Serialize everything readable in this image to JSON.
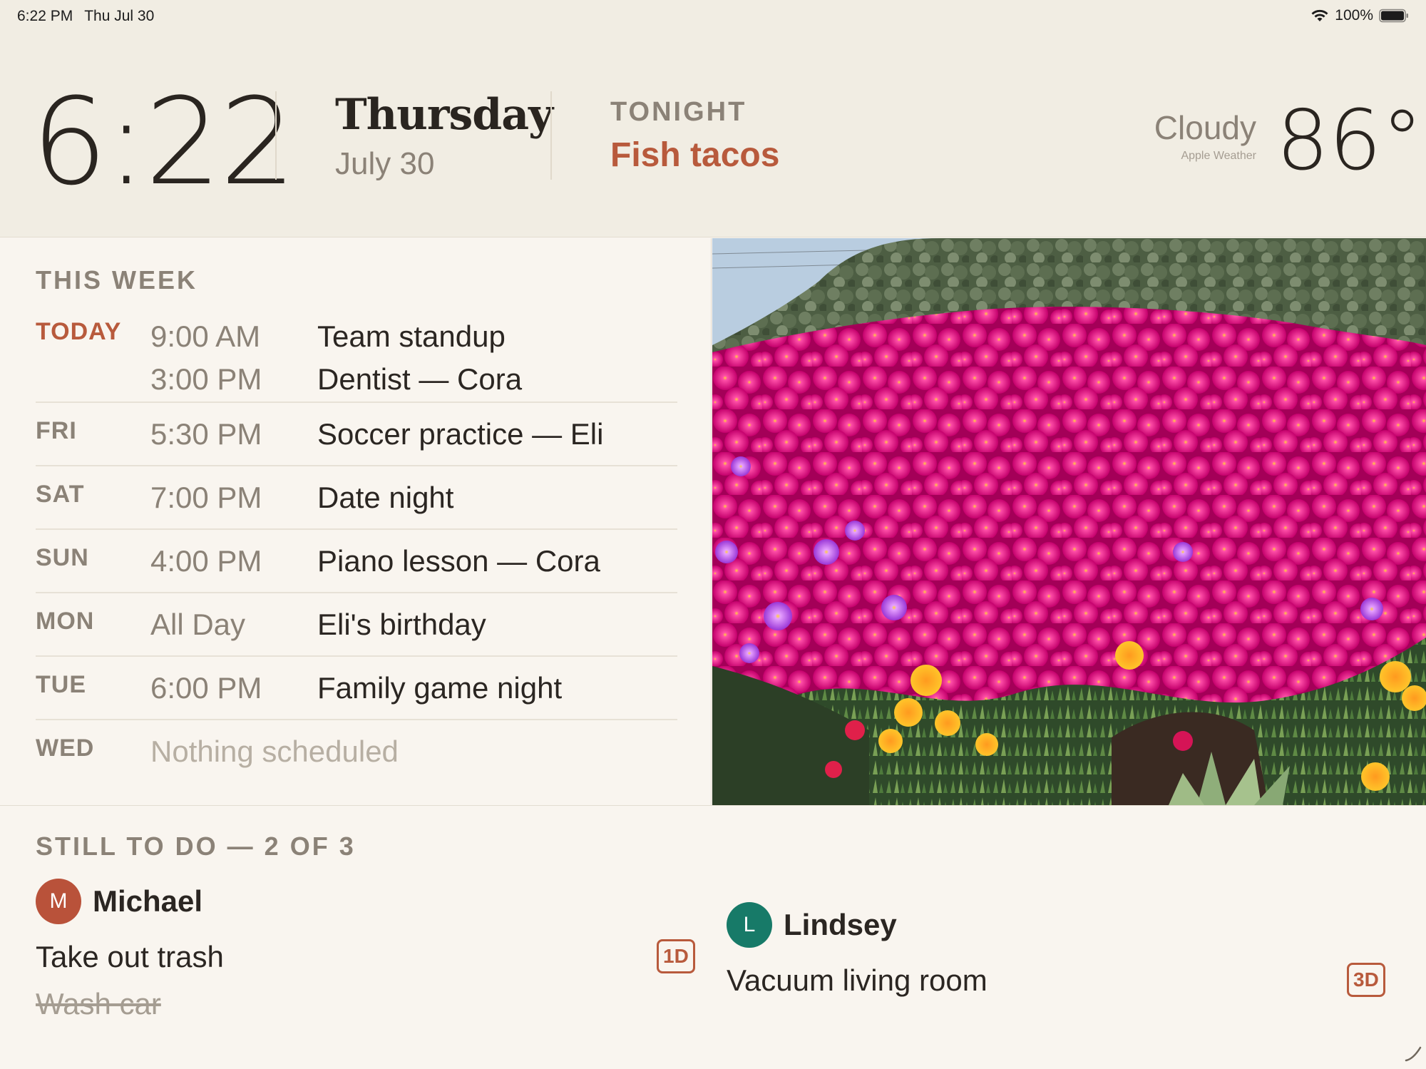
{
  "status_bar": {
    "time": "6:22 PM",
    "date": "Thu Jul 30",
    "battery": "100%",
    "icons": [
      "wifi-icon",
      "battery-icon"
    ]
  },
  "header": {
    "clock": "6:22",
    "day_name": "Thursday",
    "date": "July 30",
    "tonight_label": "TONIGHT",
    "tonight_value": "Fish tacos",
    "weather_condition": "Cloudy",
    "weather_source": "Apple Weather",
    "temperature": "86°"
  },
  "week": {
    "title": "THIS WEEK",
    "days": [
      {
        "label": "TODAY",
        "events": [
          {
            "time": "9:00 AM",
            "title": "Team standup"
          },
          {
            "time": "3:00 PM",
            "title": "Dentist — Cora"
          }
        ]
      },
      {
        "label": "FRI",
        "events": [
          {
            "time": "5:30 PM",
            "title": "Soccer practice — Eli"
          }
        ]
      },
      {
        "label": "SAT",
        "events": [
          {
            "time": "7:00 PM",
            "title": "Date night"
          }
        ]
      },
      {
        "label": "SUN",
        "events": [
          {
            "time": "4:00 PM",
            "title": "Piano lesson — Cora"
          }
        ]
      },
      {
        "label": "MON",
        "events": [
          {
            "time": "All Day",
            "title": "Eli's birthday"
          }
        ]
      },
      {
        "label": "TUE",
        "events": [
          {
            "time": "6:00 PM",
            "title": "Family game night"
          }
        ]
      },
      {
        "label": "WED",
        "empty": "Nothing scheduled"
      }
    ]
  },
  "todo": {
    "title": "STILL TO DO — 2 OF 3",
    "people": [
      {
        "initial": "M",
        "name": "Michael",
        "color": "#b9523a",
        "tasks": [
          {
            "text": "Take out trash",
            "due": "1D",
            "done": false
          },
          {
            "text": "Wash car",
            "done": true
          }
        ]
      },
      {
        "initial": "L",
        "name": "Lindsey",
        "color": "#177a68",
        "tasks": [
          {
            "text": "Vacuum living room",
            "due": "3D",
            "done": false
          }
        ]
      }
    ]
  },
  "colors": {
    "accent": "#b85a3c",
    "header_bg": "#f1ede3",
    "body_bg": "#f9f5ef",
    "muted_text": "#8b8277"
  }
}
